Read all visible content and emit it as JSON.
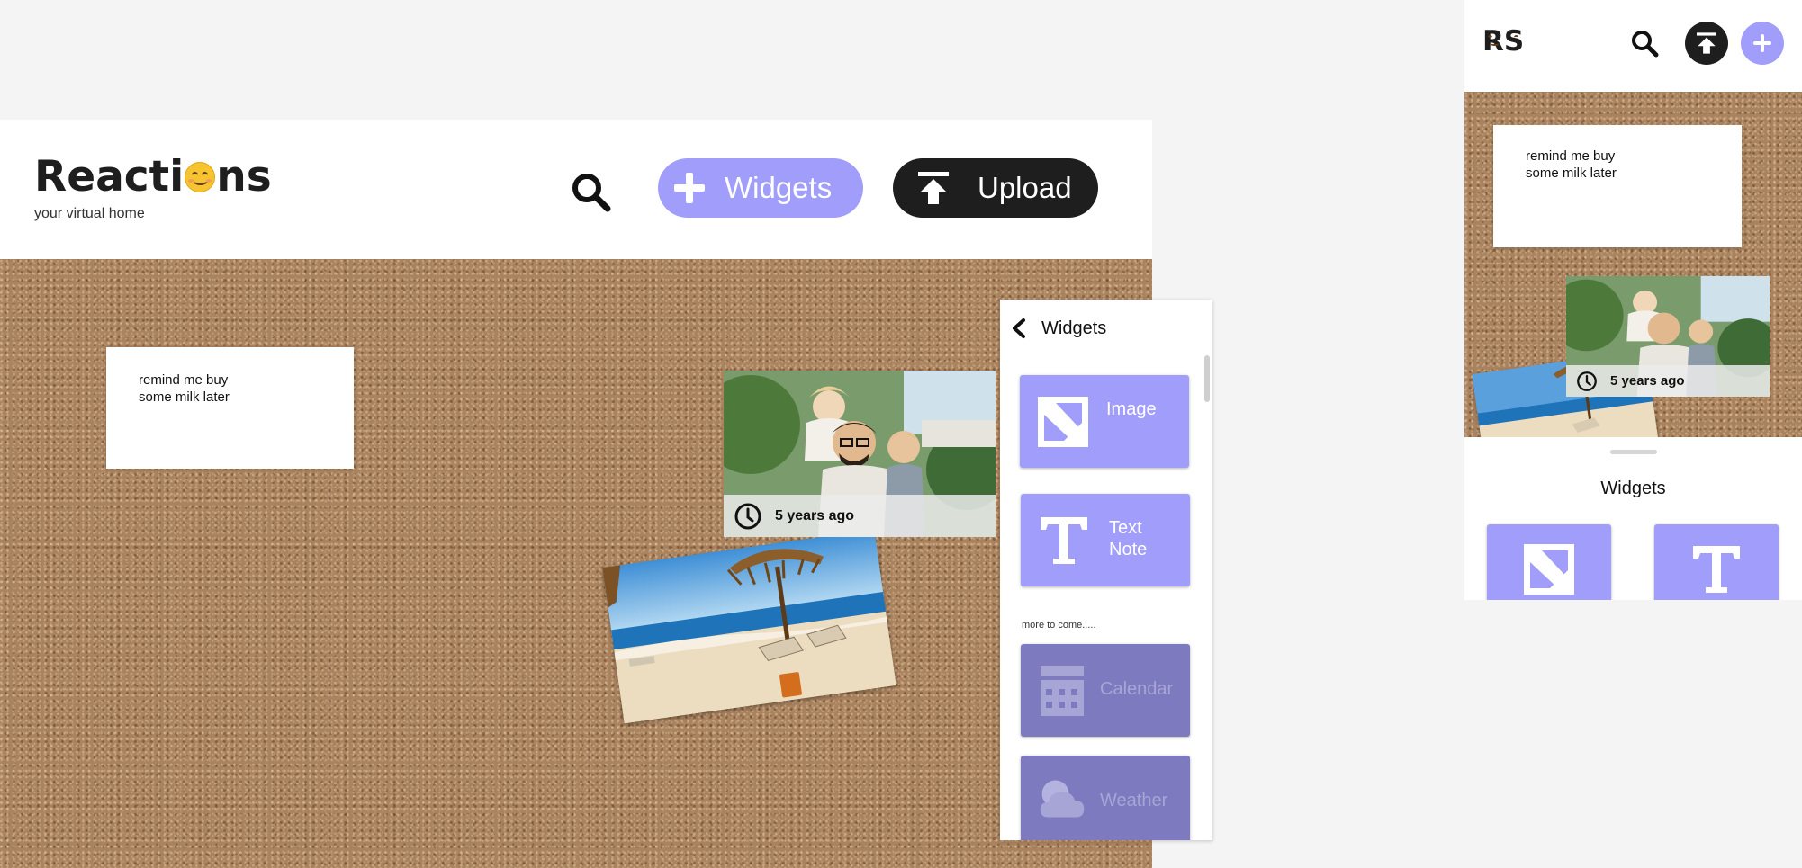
{
  "desktop": {
    "logo_pre": "Reacti",
    "logo_post": "ns",
    "tagline": "your virtual home",
    "search_icon": "search-icon",
    "widgets_label": "Widgets",
    "upload_label": "Upload",
    "note_text": "remind me buy\nsome milk later",
    "photo_time": "5 years ago",
    "panel": {
      "title": "Widgets",
      "back_icon": "chevron-left-icon",
      "cards": [
        {
          "label": "Image",
          "icon": "image-icon",
          "enabled": true
        },
        {
          "label": "Text\nNote",
          "icon": "text-icon",
          "enabled": true
        }
      ],
      "more_label": "more to come.....",
      "coming": [
        {
          "label": "Calendar",
          "icon": "calendar-icon",
          "enabled": false
        },
        {
          "label": "Weather",
          "icon": "weather-icon",
          "enabled": false
        }
      ]
    }
  },
  "mobile": {
    "logo_pre": "R",
    "logo_post": "S",
    "note_text": "remind me buy\nsome milk later",
    "photo_time": "5 years ago",
    "widgets_title": "Widgets"
  },
  "colors": {
    "accent": "#a19dfb",
    "accent_disabled": "#7e7ac0",
    "dark": "#1e1e1e",
    "cork": "#a9825e"
  }
}
